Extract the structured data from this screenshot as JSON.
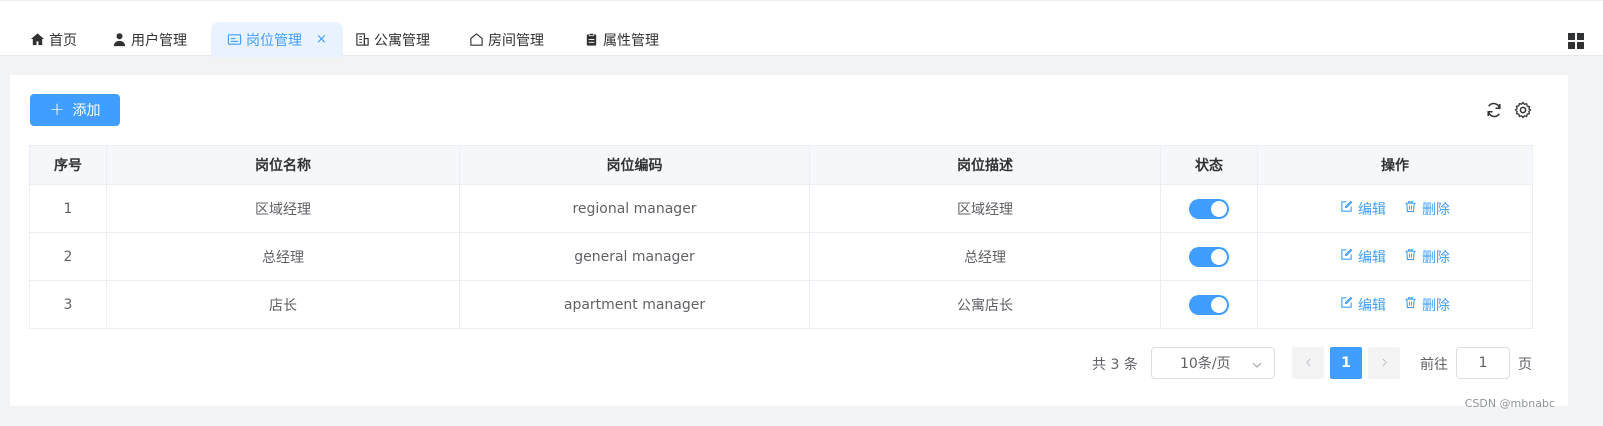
{
  "tabs": [
    {
      "label": "首页",
      "icon": "home-icon"
    },
    {
      "label": "用户管理",
      "icon": "user-icon"
    },
    {
      "label": "岗位管理",
      "icon": "id-card-icon",
      "active": true,
      "close": "×"
    },
    {
      "label": "公寓管理",
      "icon": "building-icon"
    },
    {
      "label": "房间管理",
      "icon": "house-icon"
    },
    {
      "label": "属性管理",
      "icon": "clipboard-icon"
    }
  ],
  "toolbar": {
    "add_label": "添加",
    "add_icon": "plus-icon",
    "refresh_icon": "refresh-icon",
    "settings_icon": "gear-icon"
  },
  "table": {
    "headers": [
      "序号",
      "岗位名称",
      "岗位编码",
      "岗位描述",
      "状态",
      "操作"
    ],
    "rows": [
      {
        "index": "1",
        "name": "区域经理",
        "code": "regional manager",
        "desc": "区域经理",
        "status": true
      },
      {
        "index": "2",
        "name": "总经理",
        "code": "general manager",
        "desc": "总经理",
        "status": true
      },
      {
        "index": "3",
        "name": "店长",
        "code": "apartment manager",
        "desc": "公寓店长",
        "status": true
      }
    ],
    "edit_label": "编辑",
    "delete_label": "删除"
  },
  "pagination": {
    "total_text": "共 3 条",
    "page_size": "10条/页",
    "current_page": "1",
    "goto_label": "前往",
    "goto_value": "1",
    "goto_unit": "页"
  },
  "watermark": "CSDN @mbnabc",
  "colors": {
    "accent": "#409eff",
    "header_bg": "#f5f7fa",
    "page_bg": "#f2f3f5"
  }
}
